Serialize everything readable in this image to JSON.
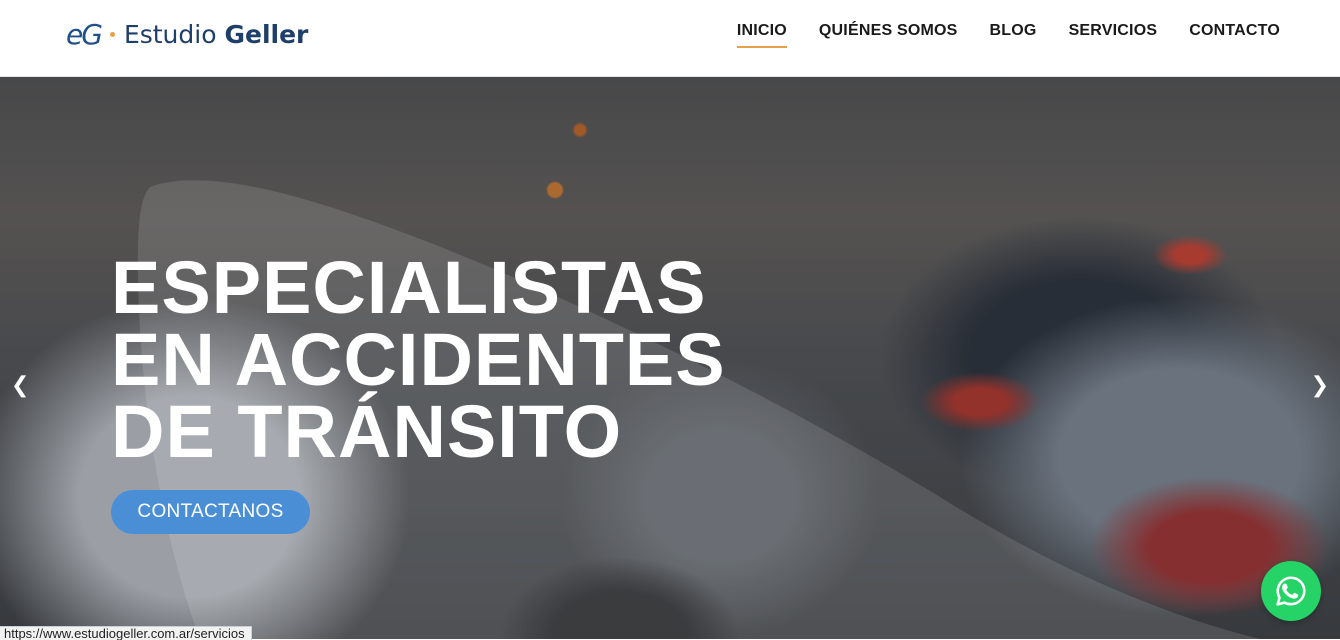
{
  "header": {
    "logo": {
      "mark": "eG",
      "name_light": "Estudio",
      "name_bold": "Geller"
    },
    "nav": [
      {
        "label": "INICIO",
        "active": true
      },
      {
        "label": "QUIÉNES SOMOS",
        "active": false
      },
      {
        "label": "BLOG",
        "active": false
      },
      {
        "label": "SERVICIOS",
        "active": false
      },
      {
        "label": "CONTACTO",
        "active": false
      }
    ]
  },
  "hero": {
    "title": "ESPECIALISTAS EN ACCIDENTES DE TRÁNSITO",
    "cta_label": "CONTACTANOS",
    "prev_arrow": "❮",
    "next_arrow": "❯"
  },
  "status_bar": {
    "url": "https://www.estudiogeller.com.ar/servicios"
  },
  "icons": {
    "whatsapp": "whatsapp-icon",
    "prev": "chevron-left-icon",
    "next": "chevron-right-icon"
  },
  "colors": {
    "accent": "#e5a14a",
    "brand_blue": "#1f4f8a",
    "cta": "#4a8fd6",
    "whatsapp": "#25d366"
  }
}
